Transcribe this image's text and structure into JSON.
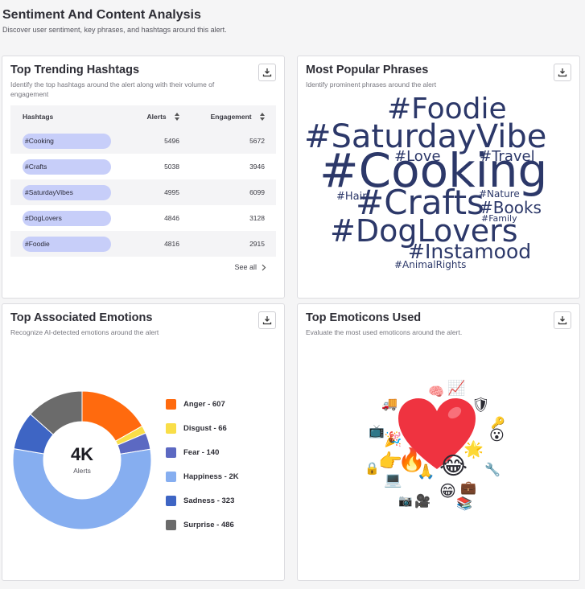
{
  "page": {
    "title": "Sentiment And Content Analysis",
    "subtitle": "Discover user sentiment, key phrases, and hashtags around this alert."
  },
  "hashtags_card": {
    "title": "Top Trending Hashtags",
    "subtitle": "Identify the top hashtags around the alert along with their volume of engagement",
    "columns": [
      "Hashtags",
      "Alerts",
      "Engagement"
    ],
    "rows": [
      {
        "tag": "#Cooking",
        "alerts": "5496",
        "engagement": "5672"
      },
      {
        "tag": "#Crafts",
        "alerts": "5038",
        "engagement": "3946"
      },
      {
        "tag": "#SaturdayVibes",
        "alerts": "4995",
        "engagement": "6099"
      },
      {
        "tag": "#DogLovers",
        "alerts": "4846",
        "engagement": "3128"
      },
      {
        "tag": "#Foodie",
        "alerts": "4816",
        "engagement": "2915"
      }
    ],
    "see_all": "See all"
  },
  "phrases_card": {
    "title": "Most Popular Phrases",
    "subtitle": "Identify prominent phrases around the alert",
    "words": [
      {
        "text": "#Foodie",
        "size": 36
      },
      {
        "text": "#SaturdayVibe",
        "size": 40
      },
      {
        "text": "#Love",
        "size": 18
      },
      {
        "text": "#Travel",
        "size": 18
      },
      {
        "text": "#Cooking",
        "size": 58
      },
      {
        "text": "#Hair",
        "size": 13
      },
      {
        "text": "#Nature",
        "size": 12
      },
      {
        "text": "#Crafts",
        "size": 42
      },
      {
        "text": "#Books",
        "size": 20
      },
      {
        "text": "#Family",
        "size": 11
      },
      {
        "text": "#DogLovers",
        "size": 38
      },
      {
        "text": "#Instamood",
        "size": 25
      },
      {
        "text": "#AnimalRights",
        "size": 12
      }
    ]
  },
  "emotions_card": {
    "title": "Top Associated Emotions",
    "subtitle": "Recognize AI-detected emotions around the alert",
    "center_value": "4K",
    "center_label": "Alerts",
    "legend": [
      {
        "label": "Anger - 607",
        "name": "Anger",
        "value": 607,
        "color": "#ff6a0e"
      },
      {
        "label": "Disgust - 66",
        "name": "Disgust",
        "value": 66,
        "color": "#f9de48"
      },
      {
        "label": "Fear - 140",
        "name": "Fear",
        "value": 140,
        "color": "#5c69c2"
      },
      {
        "label": "Happiness - 2K",
        "name": "Happiness",
        "value": 2000,
        "color": "#86aef0"
      },
      {
        "label": "Sadness - 323",
        "name": "Sadness",
        "value": 323,
        "color": "#3e65c4"
      },
      {
        "label": "Surprise - 486",
        "name": "Surprise",
        "value": 486,
        "color": "#6b6b6b"
      }
    ]
  },
  "emoticons_card": {
    "title": "Top Emoticons Used",
    "subtitle": "Evaluate the most used emoticons around the alert.",
    "emojis": [
      {
        "char": "❤",
        "name": "heart"
      },
      {
        "char": "😂",
        "name": "laughing"
      },
      {
        "char": "🔥",
        "name": "fire"
      },
      {
        "char": "👉",
        "name": "pointing"
      },
      {
        "char": "🙏",
        "name": "praying"
      },
      {
        "char": "😁",
        "name": "grinning"
      },
      {
        "char": "🎉",
        "name": "party"
      },
      {
        "char": "📈",
        "name": "chart"
      },
      {
        "char": "🛡",
        "name": "shield"
      },
      {
        "char": "🔑",
        "name": "key"
      },
      {
        "char": "😮",
        "name": "surprised"
      },
      {
        "char": "🌟",
        "name": "star"
      },
      {
        "char": "💼",
        "name": "briefcase"
      },
      {
        "char": "🔒",
        "name": "lock"
      },
      {
        "char": "💻",
        "name": "laptop"
      },
      {
        "char": "📷",
        "name": "camera"
      },
      {
        "char": "🎥",
        "name": "camera-video"
      },
      {
        "char": "📚",
        "name": "books"
      },
      {
        "char": "🚚",
        "name": "truck"
      },
      {
        "char": "📺",
        "name": "tv"
      },
      {
        "char": "🔧",
        "name": "wrench"
      },
      {
        "char": "🧠",
        "name": "brain"
      }
    ]
  }
}
